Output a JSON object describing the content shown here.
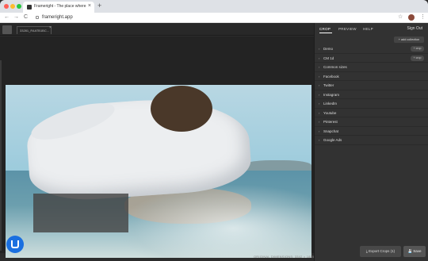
{
  "browser": {
    "tab_title": "Frameright - The place where...",
    "tab_close": "×",
    "new_tab": "+",
    "url": "frameright.app",
    "nav_back": "←",
    "nav_forward": "→",
    "reload": "C",
    "bookmark_icon": "star-icon",
    "menu_icon": "⋮"
  },
  "app": {
    "file_tab_label": "33281_R4ATB1BC...",
    "file_tab_close": "×"
  },
  "panel": {
    "tabs": [
      "CROP",
      "PREVIEW",
      "HELP"
    ],
    "sign_out": "Sign Out",
    "add_collection": "+ add collection",
    "items": [
      {
        "label": "Demo",
        "button": "+ crop"
      },
      {
        "label": "CM 1d",
        "button": "+ crop"
      },
      {
        "label": "Common sizes",
        "button": ""
      },
      {
        "label": "Facebook",
        "button": ""
      },
      {
        "label": "Twitter",
        "button": ""
      },
      {
        "label": "Instagram",
        "button": ""
      },
      {
        "label": "LinkedIn",
        "button": ""
      },
      {
        "label": "Youtube",
        "button": ""
      },
      {
        "label": "Pinterest",
        "button": ""
      },
      {
        "label": "Snapchat",
        "button": ""
      },
      {
        "label": "Google Ads",
        "button": ""
      }
    ],
    "chevron": "›",
    "export_label": "⤓ Export Crops (1)",
    "save_label": "💾 Save"
  },
  "canvas": {
    "meta_text": "ORIGINAL DIMENSIONS: 3342 × 1885 px"
  },
  "colors": {
    "chat_accent": "#1a6fe0",
    "panel_bg": "#323232",
    "canvas_bg": "#232323"
  }
}
